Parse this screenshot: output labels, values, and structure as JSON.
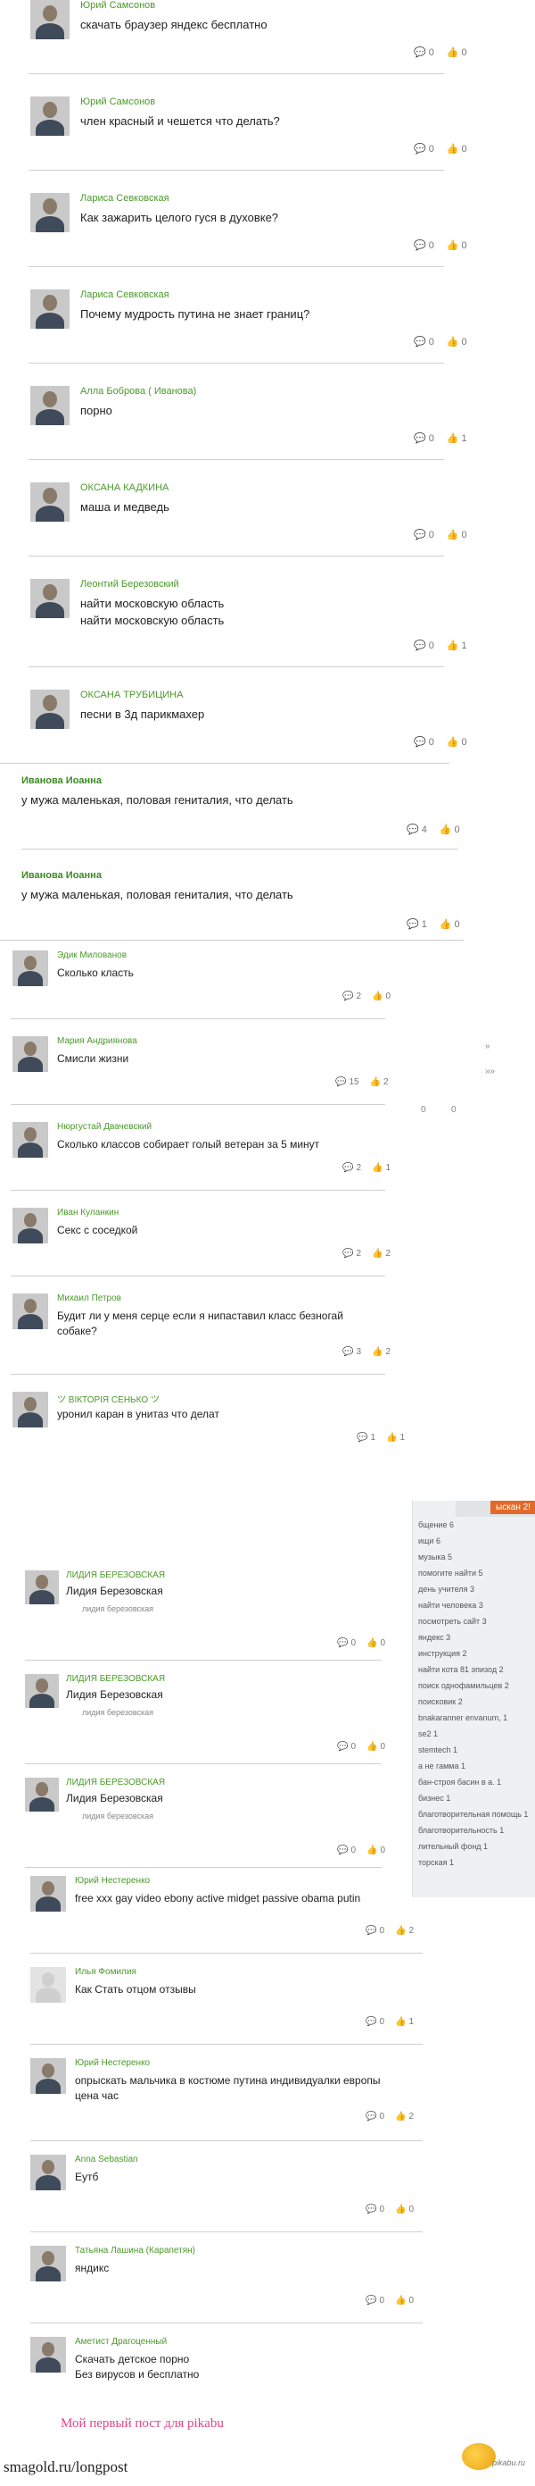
{
  "block1": [
    {
      "name": "Юрий Самсонов",
      "question": "скачать браузер яндекс бесплатно",
      "answers": "0",
      "likes": "0"
    },
    {
      "name": "Юрий Самсонов",
      "question": "член красный и чешется что делать?",
      "answers": "0",
      "likes": "0"
    },
    {
      "name": "Лариса Севковская",
      "question": "Как зажарить целого гуся в духовке?",
      "answers": "0",
      "likes": "0"
    },
    {
      "name": "Лариса Севковская",
      "question": "Почему мудрость путина не знает границ?",
      "answers": "0",
      "likes": "0"
    },
    {
      "name": "Алла Боброва ( Иванова)",
      "question": "порно",
      "answers": "0",
      "likes": "1"
    },
    {
      "name": "ОКСАНА КАДКИНА",
      "question": "маша и медведь",
      "answers": "0",
      "likes": "0"
    },
    {
      "name": "Леонтий Березовский",
      "question": "найти московскую область",
      "question2": "найти московскую область",
      "answers": "0",
      "likes": "1"
    },
    {
      "name": "ОКСАНА ТРУБИЦИНА",
      "question": "песни в 3д парикмахер",
      "answers": "0",
      "likes": "0"
    }
  ],
  "block2": [
    {
      "name": "Иванова Иоанна",
      "question": "у мужа маленькая, половая гениталия, что делать",
      "answers": "4",
      "likes": "0"
    },
    {
      "name": "Иванова Иоанна",
      "question": "у мужа маленькая, половая гениталия, что делать",
      "answers": "1",
      "likes": "0"
    }
  ],
  "block3": [
    {
      "name": "Эдик Милованов",
      "question": "Сколько класть",
      "answers": "2",
      "likes": "0"
    },
    {
      "name": "Мария Андриянова",
      "question": "Смисли жизни",
      "answers": "15",
      "likes": "2"
    },
    {
      "name": "Нюргустай Двачевский",
      "question": "Сколько классов собирает голый ветеран за 5 минут",
      "answers": "2",
      "likes": "1"
    },
    {
      "name": "Иван Куланкин",
      "question": "Секс с соседкой",
      "answers": "2",
      "likes": "2"
    },
    {
      "name": "Михаил Петров",
      "question": "Будит ли у меня серце если я нипаставил класс безногай",
      "question2": "собаке?",
      "answers": "3",
      "likes": "2"
    },
    {
      "name": "ツ ВIКТОРIЯ СЕНЬКО ツ",
      "question": "уронил каран в унитаз что делат",
      "answers": "1",
      "likes": "1"
    }
  ],
  "block4": [
    {
      "name": "ЛИДИЯ БЕРЕЗОВСКАЯ",
      "question": "Лидия Березовская",
      "sub": "лидия березовская",
      "answers": "0",
      "likes": "0"
    },
    {
      "name": "ЛИДИЯ БЕРЕЗОВСКАЯ",
      "question": "Лидия Березовская",
      "sub": "лидия березовская",
      "answers": "0",
      "likes": "0"
    },
    {
      "name": "ЛИДИЯ БЕРЕЗОВСКАЯ",
      "question": "Лидия Березовская",
      "sub": "лидия березовская",
      "answers": "0",
      "likes": "0"
    }
  ],
  "block5": [
    {
      "name": "Юрий Нестеренко",
      "question": "free xxx gay video ebony active midget passive obama putin",
      "answers": "0",
      "likes": "2"
    },
    {
      "name": "Илья Фомилия",
      "question": "Как Стать отцом отзывы",
      "answers": "0",
      "likes": "1"
    },
    {
      "name": "Юрий Нестеренко",
      "question": "опрыскать мальчика в костюме путина индивидуалки европы",
      "question2": "цена час",
      "answers": "0",
      "likes": "2"
    },
    {
      "name": "Anna Sebastian",
      "question": "Еутб",
      "answers": "0",
      "likes": "0"
    },
    {
      "name": "Татьяна Лашина (Карапетян)",
      "question": "яндикс",
      "answers": "0",
      "likes": "0"
    },
    {
      "name": "Аметист Драгоценный",
      "question": "Скачать детское порно",
      "question2": "Без вирусов и бесплатно"
    }
  ],
  "side_panel": {
    "tag": "ыскан 2!",
    "items": [
      "бщение 6",
      "ищи 6",
      "музыка 5",
      "помогите найти 5",
      "день учителя 3",
      "найти человека 3",
      "посмотреть сайт 3",
      "яндекс 3",
      "инструкция 2",
      "найти кота 81 эпизод 2",
      "поиск однофамильцев 2",
      "поисковик 2",
      "bnakaranner envanum, 1",
      "se2 1",
      "stemtech 1",
      "а не гамма 1",
      "бан-строя басин в а. 1",
      "бизнес 1",
      "благотворительная помощь 1",
      "благотворительность 1",
      "лительный фонд 1",
      "торская 1"
    ]
  },
  "fragments": {
    "f1": "»",
    "f2": "»»",
    "f3": "0",
    "f4": "0"
  },
  "footer": {
    "pikabu_link": "Мой первый пост для pikabu",
    "watermark": "smagold.ru/longpost",
    "logo_text": "pikabu.ru"
  }
}
